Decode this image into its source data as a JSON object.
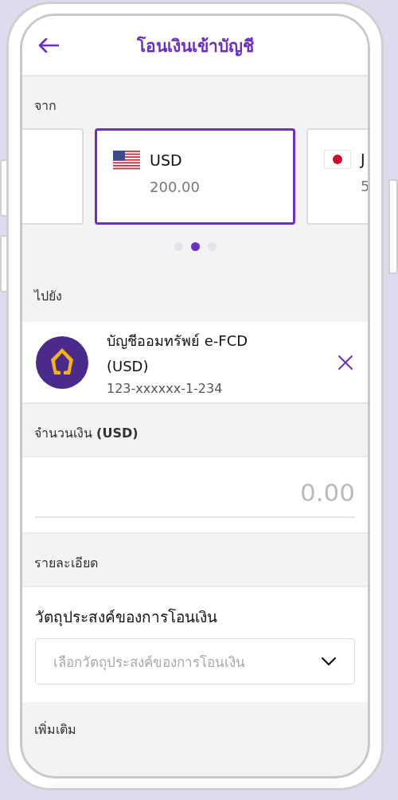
{
  "header": {
    "title": "โอนเงินเข้าบัญชี"
  },
  "from": {
    "label": "จาก",
    "cards": [
      {
        "kind": "blank",
        "selected": false
      },
      {
        "kind": "us",
        "currency": "USD",
        "balance": "200.00",
        "selected": true
      },
      {
        "kind": "jp",
        "currency": "J",
        "balance": "5",
        "selected": false
      }
    ],
    "dots": [
      {
        "selected": false
      },
      {
        "selected": true
      },
      {
        "selected": false
      }
    ]
  },
  "to": {
    "label": "ไปยัง",
    "account": {
      "name": "บัญชีออมทรัพย์ e-FCD (USD)",
      "number": "123-xxxxxx-1-234"
    }
  },
  "amount": {
    "label": "จำนวนเงิน **(USD)**",
    "placeholder": "0.00"
  },
  "details": {
    "label": "รายละเอียด",
    "purpose_label": "วัตถุประสงค์ของการโอนเงิน",
    "purpose_placeholder": "เลือกวัตถุประสงค์ของการโอนเงิน"
  },
  "more": {
    "label": "เพิ่มเติม"
  }
}
